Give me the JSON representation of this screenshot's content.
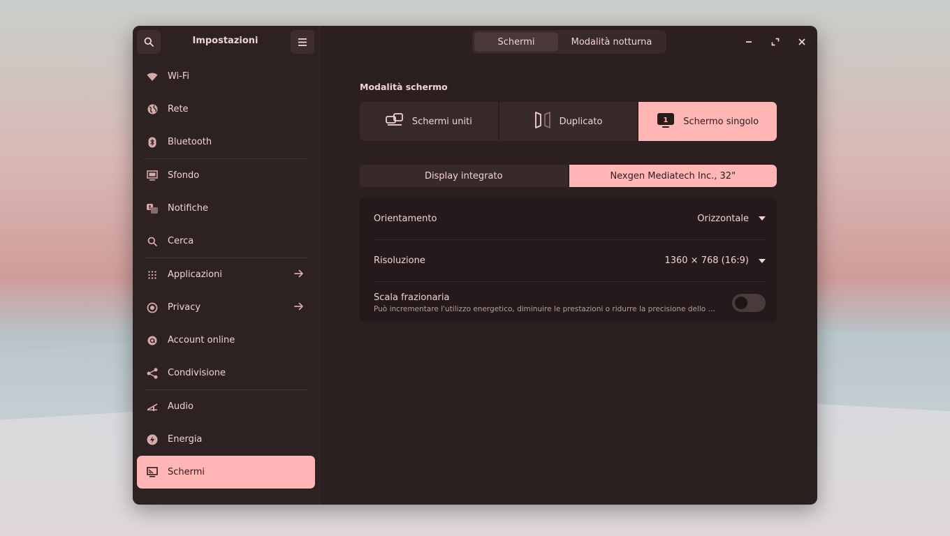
{
  "sidebar": {
    "title": "Impostazioni",
    "items": [
      {
        "label": "Wi-Fi",
        "icon": "wifi-icon"
      },
      {
        "label": "Rete",
        "icon": "network-icon"
      },
      {
        "label": "Bluetooth",
        "icon": "bluetooth-icon"
      },
      {
        "label": "Sfondo",
        "icon": "wallpaper-icon"
      },
      {
        "label": "Notifiche",
        "icon": "notifications-icon"
      },
      {
        "label": "Cerca",
        "icon": "search-icon"
      },
      {
        "label": "Applicazioni",
        "icon": "apps-grid-icon"
      },
      {
        "label": "Privacy",
        "icon": "privacy-icon"
      },
      {
        "label": "Account online",
        "icon": "at-icon"
      },
      {
        "label": "Condivisione",
        "icon": "share-icon"
      },
      {
        "label": "Audio",
        "icon": "audio-icon"
      },
      {
        "label": "Energia",
        "icon": "power-icon"
      },
      {
        "label": "Schermi",
        "icon": "display-icon"
      }
    ]
  },
  "header": {
    "tabs": [
      "Schermi",
      "Modalità notturna"
    ],
    "active_tab": "Schermi"
  },
  "display_mode": {
    "title": "Modalità schermo",
    "options": [
      "Schermi uniti",
      "Duplicato",
      "Schermo singolo"
    ],
    "active": "Schermo singolo"
  },
  "monitors": {
    "options": [
      "Display integrato",
      "Nexgen Mediatech Inc., 32\""
    ],
    "active": "Nexgen Mediatech Inc., 32\""
  },
  "settings": {
    "orientation": {
      "label": "Orientamento",
      "value": "Orizzontale"
    },
    "resolution": {
      "label": "Risoluzione",
      "value": "1360 × 768 (16:9)"
    },
    "fractional_scaling": {
      "label": "Scala frazionaria",
      "description": "Può incrementare l'utilizzo energetico, diminuire le prestazioni o ridurre la precisione dello schermo.",
      "enabled": false
    }
  },
  "colors": {
    "accent": "#ffb6b5",
    "window_bg": "#2b1f20",
    "text": "#f2d3d1"
  }
}
